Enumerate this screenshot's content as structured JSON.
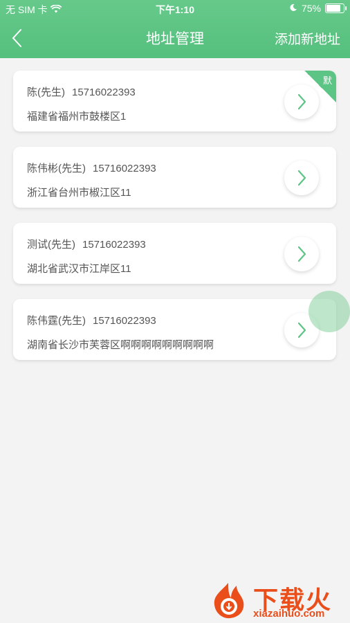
{
  "status_bar": {
    "carrier": "无 SIM 卡",
    "time": "下午1:10",
    "battery_percent": "75%",
    "battery_level": 0.75
  },
  "nav": {
    "title": "地址管理",
    "add_label": "添加新地址"
  },
  "addresses": [
    {
      "name": "陈(先生)",
      "phone": "15716022393",
      "address": "福建省福州市鼓楼区1",
      "is_default": true,
      "badge": "默"
    },
    {
      "name": "陈伟彬(先生)",
      "phone": "15716022393",
      "address": "浙江省台州市椒江区11",
      "is_default": false
    },
    {
      "name": "测试(先生)",
      "phone": "15716022393",
      "address": "湖北省武汉市江岸区11",
      "is_default": false
    },
    {
      "name": "陈伟霆(先生)",
      "phone": "15716022393",
      "address": "湖南省长沙市芙蓉区啊啊啊啊啊啊啊啊啊",
      "is_default": false
    }
  ],
  "watermark": {
    "title": "下载火",
    "url": "xiazaihuo.com"
  },
  "colors": {
    "accent": "#5cc585",
    "header": "#5cc381",
    "text": "#555555",
    "background": "#f3f3f3",
    "watermark": "#e94e1b"
  }
}
